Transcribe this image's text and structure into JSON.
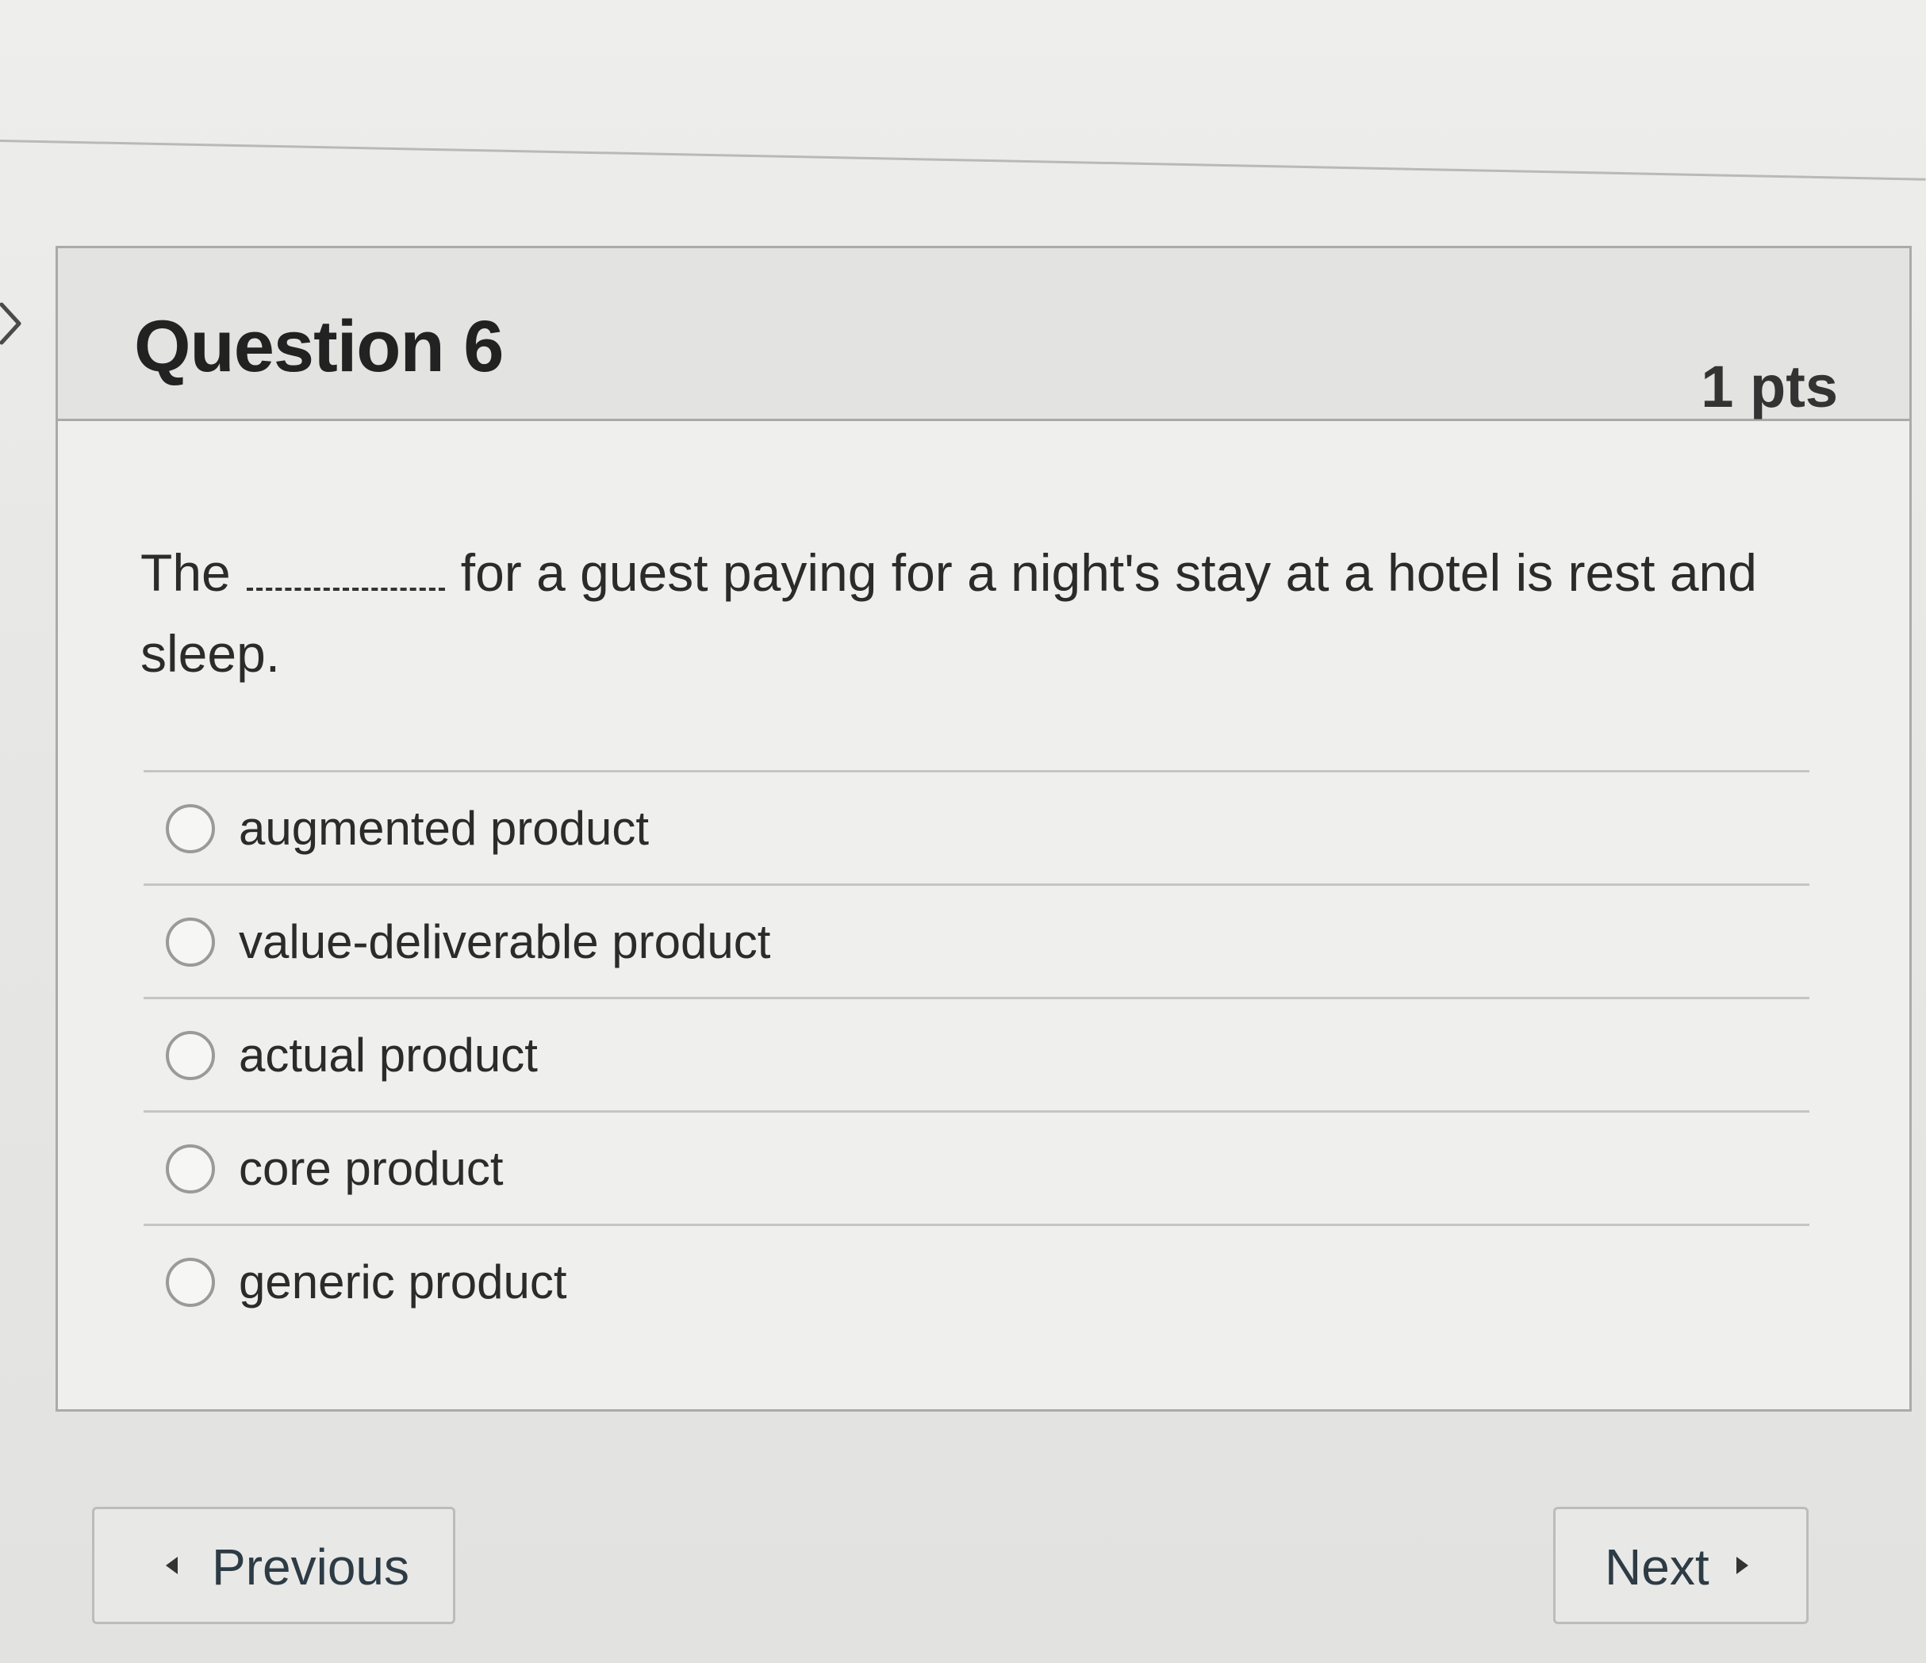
{
  "question": {
    "title": "Question 6",
    "points": "1 pts",
    "text_before": "The",
    "text_after": "for a guest paying for a night's stay at a hotel is rest and sleep.",
    "answers": [
      {
        "label": "augmented product"
      },
      {
        "label": "value-deliverable product"
      },
      {
        "label": "actual product"
      },
      {
        "label": "core product"
      },
      {
        "label": "generic product"
      }
    ]
  },
  "navigation": {
    "previous_label": "Previous",
    "next_label": "Next"
  },
  "icons": {
    "collapse": "chevron-right-icon",
    "previous": "triangle-left-icon",
    "next": "triangle-right-icon"
  }
}
